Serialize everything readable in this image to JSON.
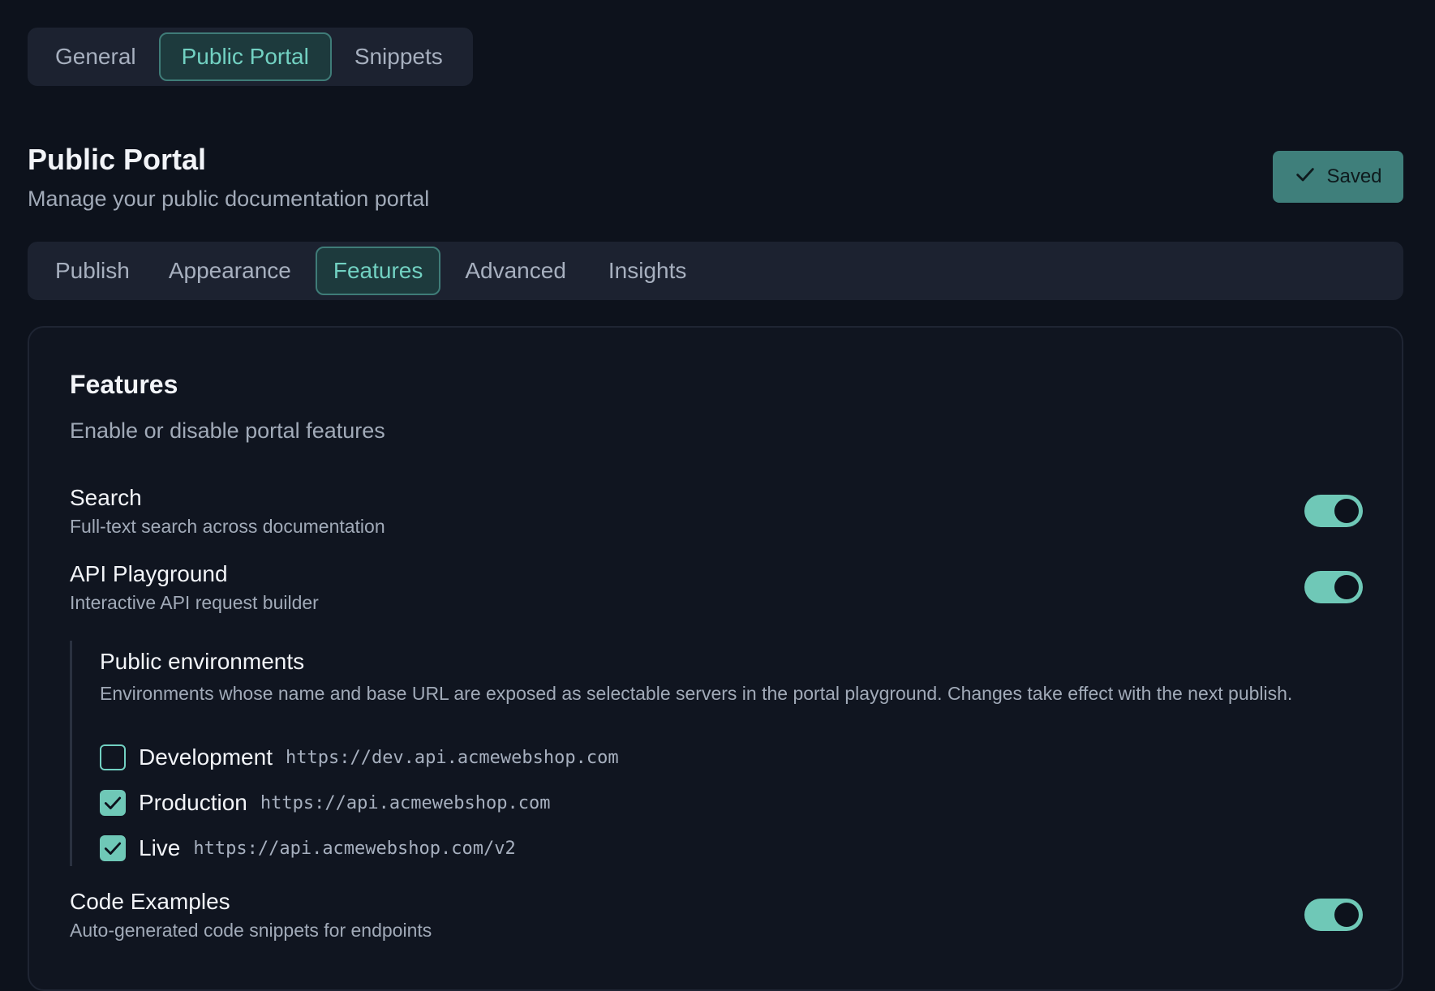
{
  "top_tabs": [
    {
      "label": "General",
      "active": false
    },
    {
      "label": "Public Portal",
      "active": true
    },
    {
      "label": "Snippets",
      "active": false
    }
  ],
  "page": {
    "title": "Public Portal",
    "subtitle": "Manage your public documentation portal",
    "saved_label": "Saved"
  },
  "sub_tabs": [
    {
      "label": "Publish",
      "active": false
    },
    {
      "label": "Appearance",
      "active": false
    },
    {
      "label": "Features",
      "active": true
    },
    {
      "label": "Advanced",
      "active": false
    },
    {
      "label": "Insights",
      "active": false
    }
  ],
  "features_card": {
    "title": "Features",
    "subtitle": "Enable or disable portal features",
    "items": [
      {
        "name": "Search",
        "description": "Full-text search across documentation",
        "enabled": true
      },
      {
        "name": "API Playground",
        "description": "Interactive API request builder",
        "enabled": true
      },
      {
        "name": "Code Examples",
        "description": "Auto-generated code snippets for endpoints",
        "enabled": true
      }
    ],
    "environments": {
      "title": "Public environments",
      "description": "Environments whose name and base URL are exposed as selectable servers in the portal playground. Changes take effect with the next publish.",
      "list": [
        {
          "name": "Development",
          "url": "https://dev.api.acmewebshop.com",
          "checked": false
        },
        {
          "name": "Production",
          "url": "https://api.acmewebshop.com",
          "checked": true
        },
        {
          "name": "Live",
          "url": "https://api.acmewebshop.com/v2",
          "checked": true
        }
      ]
    }
  },
  "colors": {
    "background": "#0d121c",
    "accent": "#6fc8b7",
    "active_tab_text": "#72d1c2",
    "saved_button": "#3f7f7b"
  }
}
